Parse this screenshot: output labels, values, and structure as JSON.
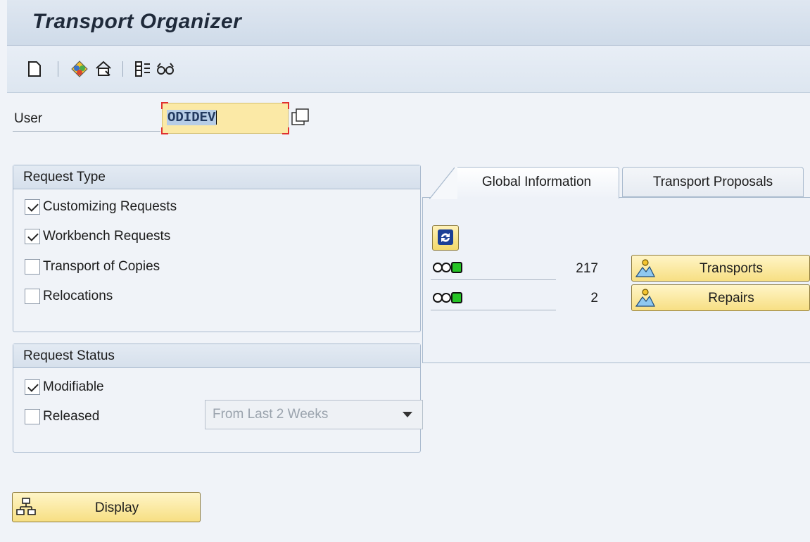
{
  "window": {
    "title": "Transport Organizer"
  },
  "toolbar": {
    "icons": [
      "new-document-icon",
      "object-list-icon",
      "transport-route-icon",
      "tools-icon",
      "glasses-icon"
    ]
  },
  "user": {
    "label": "User",
    "value": "ODIDEV"
  },
  "request_type": {
    "title": "Request Type",
    "options": [
      {
        "label": "Customizing Requests",
        "checked": true
      },
      {
        "label": "Workbench Requests",
        "checked": true
      },
      {
        "label": "Transport of Copies",
        "checked": false
      },
      {
        "label": "Relocations",
        "checked": false
      }
    ]
  },
  "request_status": {
    "title": "Request Status",
    "modifiable": {
      "label": "Modifiable",
      "checked": true
    },
    "released": {
      "label": "Released",
      "checked": false
    },
    "period": "From Last 2 Weeks"
  },
  "tabs": {
    "active": "Global Information",
    "inactive": "Transport Proposals"
  },
  "global_info": {
    "rows": [
      {
        "status": "green",
        "count": "217",
        "button": "Transports"
      },
      {
        "status": "green",
        "count": "2",
        "button": "Repairs"
      }
    ]
  },
  "display_button": {
    "label": "Display"
  }
}
